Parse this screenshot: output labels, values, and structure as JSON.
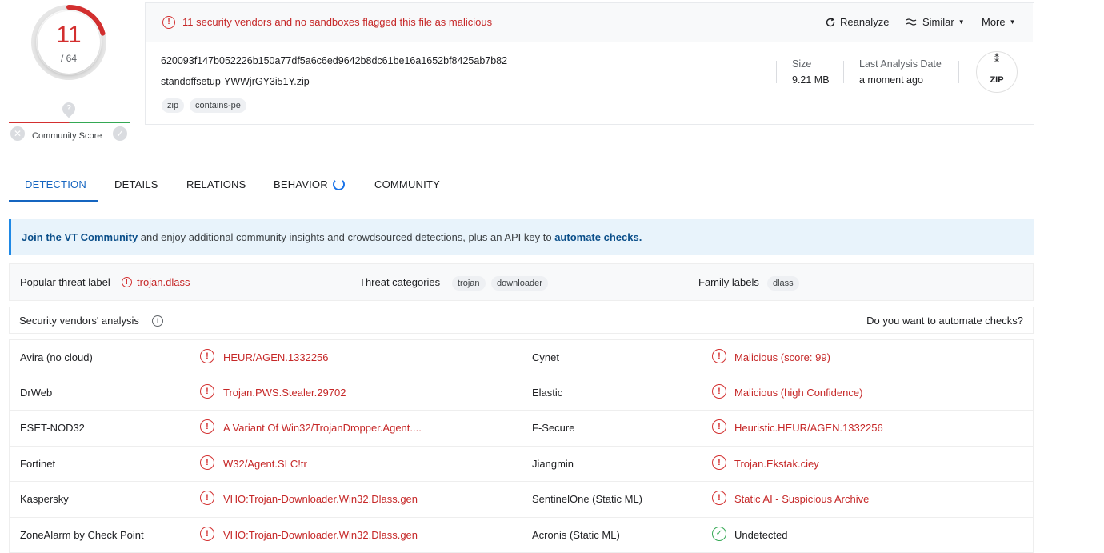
{
  "score": {
    "detected": "11",
    "total": "/ 64",
    "community_label": "Community Score",
    "pin_glyph": "?",
    "down_glyph": "✕",
    "up_glyph": "✓"
  },
  "alert": {
    "text": "11 security vendors and no sandboxes flagged this file as malicious",
    "reanalyze": "Reanalyze",
    "similar": "Similar",
    "more": "More"
  },
  "file": {
    "hash": "620093f147b052226b150a77df5a6c6ed9642b8dc61be16a1652bf8425ab7b82",
    "name": "standoffsetup-YWWjrGY3i51Y.zip",
    "tags": [
      "zip",
      "contains-pe"
    ],
    "size_label": "Size",
    "size_value": "9.21 MB",
    "date_label": "Last Analysis Date",
    "date_value": "a moment ago",
    "type_label": "ZIP"
  },
  "tabs": [
    "DETECTION",
    "DETAILS",
    "RELATIONS",
    "BEHAVIOR",
    "COMMUNITY"
  ],
  "banner": {
    "link1": "Join the VT Community",
    "middle": " and enjoy additional community insights and crowdsourced detections, plus an API key to ",
    "link2": "automate checks."
  },
  "threat": {
    "popular_label": "Popular threat label",
    "popular_value": "trojan.dlass",
    "categories_label": "Threat categories",
    "categories": [
      "trojan",
      "downloader"
    ],
    "family_label": "Family labels",
    "family": [
      "dlass"
    ]
  },
  "vendors_header": {
    "title": "Security vendors' analysis",
    "automate": "Do you want to automate checks?"
  },
  "vendors": [
    {
      "left": {
        "name": "Avira (no cloud)",
        "result": "HEUR/AGEN.1332256",
        "status": "malicious"
      },
      "right": {
        "name": "Cynet",
        "result": "Malicious (score: 99)",
        "status": "malicious"
      }
    },
    {
      "left": {
        "name": "DrWeb",
        "result": "Trojan.PWS.Stealer.29702",
        "status": "malicious"
      },
      "right": {
        "name": "Elastic",
        "result": "Malicious (high Confidence)",
        "status": "malicious"
      }
    },
    {
      "left": {
        "name": "ESET-NOD32",
        "result": "A Variant Of Win32/TrojanDropper.Agent....",
        "status": "malicious"
      },
      "right": {
        "name": "F-Secure",
        "result": "Heuristic.HEUR/AGEN.1332256",
        "status": "malicious"
      }
    },
    {
      "left": {
        "name": "Fortinet",
        "result": "W32/Agent.SLC!tr",
        "status": "malicious"
      },
      "right": {
        "name": "Jiangmin",
        "result": "Trojan.Ekstak.ciey",
        "status": "malicious"
      }
    },
    {
      "left": {
        "name": "Kaspersky",
        "result": "VHO:Trojan-Downloader.Win32.Dlass.gen",
        "status": "malicious"
      },
      "right": {
        "name": "SentinelOne (Static ML)",
        "result": "Static AI - Suspicious Archive",
        "status": "malicious"
      }
    },
    {
      "left": {
        "name": "ZoneAlarm by Check Point",
        "result": "VHO:Trojan-Downloader.Win32.Dlass.gen",
        "status": "malicious"
      },
      "right": {
        "name": "Acronis (Static ML)",
        "result": "Undetected",
        "status": "undetected"
      }
    }
  ],
  "colors": {
    "malicious": "#c62828",
    "clean": "#34a853",
    "accent": "#1565c0"
  }
}
